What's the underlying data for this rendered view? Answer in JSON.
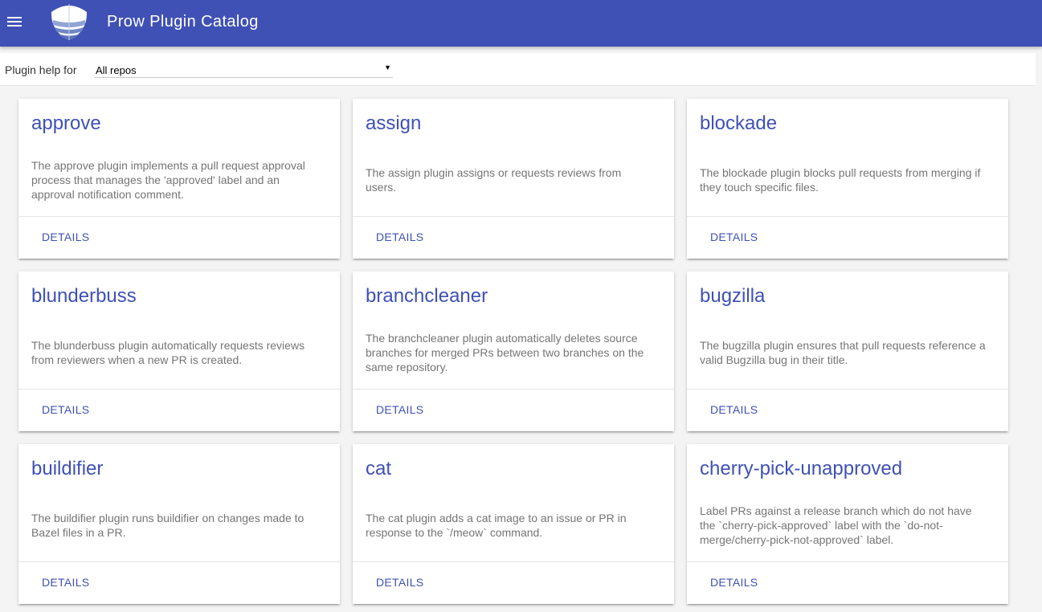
{
  "app": {
    "title": "Prow Plugin Catalog"
  },
  "filter": {
    "label": "Plugin help for",
    "selected": "All repos"
  },
  "cards": [
    {
      "name": "approve",
      "description": "The approve plugin implements a pull request approval process that manages the 'approved' label and an approval notification comment.",
      "action": "DETAILS"
    },
    {
      "name": "assign",
      "description": "The assign plugin assigns or requests reviews from users.",
      "action": "DETAILS"
    },
    {
      "name": "blockade",
      "description": "The blockade plugin blocks pull requests from merging if they touch specific files.",
      "action": "DETAILS"
    },
    {
      "name": "blunderbuss",
      "description": "The blunderbuss plugin automatically requests reviews from reviewers when a new PR is created.",
      "action": "DETAILS"
    },
    {
      "name": "branchcleaner",
      "description": "The branchcleaner plugin automatically deletes source branches for merged PRs between two branches on the same repository.",
      "action": "DETAILS"
    },
    {
      "name": "bugzilla",
      "description": "The bugzilla plugin ensures that pull requests reference a valid Bugzilla bug in their title.",
      "action": "DETAILS"
    },
    {
      "name": "buildifier",
      "description": "The buildifier plugin runs buildifier on changes made to Bazel files in a PR.",
      "action": "DETAILS"
    },
    {
      "name": "cat",
      "description": "The cat plugin adds a cat image to an issue or PR in response to the `/meow` command.",
      "action": "DETAILS"
    },
    {
      "name": "cherry-pick-unapproved",
      "description": "Label PRs against a release branch which do not have the `cherry-pick-approved` label with the `do-not-merge/cherry-pick-not-approved` label.",
      "action": "DETAILS"
    }
  ]
}
